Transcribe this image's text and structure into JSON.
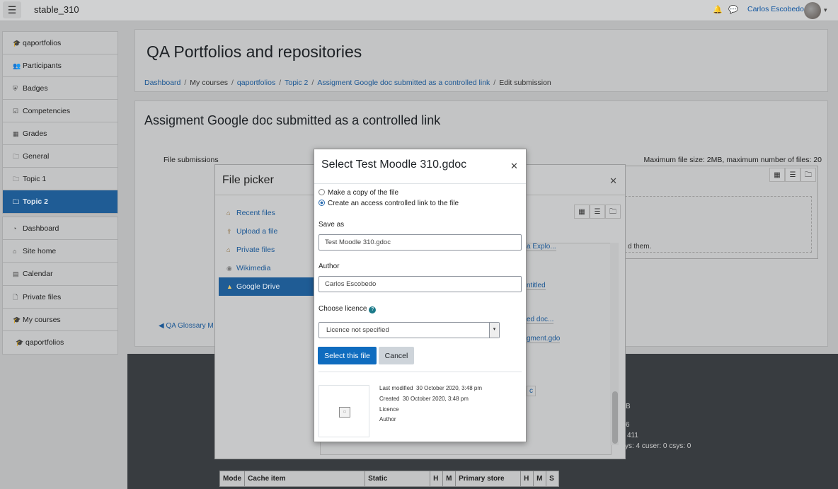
{
  "navbar": {
    "site_name": "stable_310",
    "user_name": "Carlos Escobedo"
  },
  "drawer": {
    "group1": [
      {
        "icon": "graduation-cap-icon",
        "glyph": "🎓",
        "label": "qaportfolios"
      },
      {
        "icon": "users-icon",
        "glyph": "👥",
        "label": "Participants"
      },
      {
        "icon": "shield-icon",
        "glyph": "⛨",
        "label": "Badges"
      },
      {
        "icon": "check-square-icon",
        "glyph": "☑",
        "label": "Competencies"
      },
      {
        "icon": "table-icon",
        "glyph": "▦",
        "label": "Grades"
      },
      {
        "icon": "folder-icon",
        "glyph": "🗀",
        "label": "General"
      },
      {
        "icon": "folder-icon",
        "glyph": "🗀",
        "label": "Topic 1"
      },
      {
        "icon": "folder-icon",
        "glyph": "🗀",
        "label": "Topic 2"
      }
    ],
    "group2": [
      {
        "icon": "dashboard-icon",
        "glyph": "◔",
        "label": "Dashboard"
      },
      {
        "icon": "home-icon",
        "glyph": "⌂",
        "label": "Site home"
      },
      {
        "icon": "calendar-icon",
        "glyph": "▤",
        "label": "Calendar"
      }
    ],
    "group3": [
      {
        "icon": "file-icon",
        "glyph": "🗋",
        "label": "Private files"
      }
    ],
    "group4": [
      {
        "icon": "graduation-cap-icon",
        "glyph": "🎓",
        "label": "My courses"
      },
      {
        "icon": "graduation-cap-icon",
        "glyph": "🎓",
        "label": "qaportfolios"
      }
    ],
    "active_label": "Topic 2"
  },
  "header": {
    "title": "QA Portfolios and repositories",
    "breadcrumb": [
      "Dashboard",
      "My courses",
      "qaportfolios",
      "Topic 2",
      "Assigment Google doc submitted as a controlled link",
      "Edit submission"
    ]
  },
  "main": {
    "title": "Assigment Google doc submitted as a controlled link",
    "file_submissions_label": "File submissions",
    "max_size_text": "Maximum file size: 2MB, maximum number of files: 20",
    "dropzone_text": "d them.",
    "prev_link": "◀ QA Glossary M"
  },
  "footer": {
    "lines": [
      "B",
      "6",
      "411",
      "sys: 4 cuser: 0 csys: 0"
    ],
    "cache_headers": [
      "Mode",
      "Cache item",
      "Static",
      "H",
      "M",
      "Primary store",
      "H",
      "M",
      "S"
    ]
  },
  "file_picker": {
    "title": "File picker",
    "nav": [
      {
        "icon": "recent-files-icon",
        "label": "Recent files"
      },
      {
        "icon": "upload-icon",
        "label": "Upload a file"
      },
      {
        "icon": "private-files-icon",
        "label": "Private files"
      },
      {
        "icon": "wikimedia-icon",
        "label": "Wikimedia"
      },
      {
        "icon": "google-drive-icon",
        "label": "Google Drive"
      }
    ],
    "peek_links": [
      "a Explo...",
      "ntitled",
      "ed doc...",
      "gment.gdo",
      "c"
    ]
  },
  "dialog": {
    "title": "Select Test Moodle 310.gdoc",
    "option_copy": "Make a copy of the file",
    "option_link": "Create an access controlled link to the file",
    "save_as_label": "Save as",
    "save_as_value": "Test Moodle 310.gdoc",
    "author_label": "Author",
    "author_value": "Carlos Escobedo",
    "licence_label": "Choose licence",
    "licence_value": "Licence not specified",
    "select_button": "Select this file",
    "cancel_button": "Cancel",
    "meta": {
      "last_modified_label": "Last modified",
      "last_modified_value": "30 October 2020, 3:48 pm",
      "created_label": "Created",
      "created_value": "30 October 2020, 3:48 pm",
      "licence_label": "Licence",
      "author_label": "Author"
    }
  },
  "colors": {
    "primary": "#0f6cbf",
    "link": "#1b5794",
    "active_nav": "#1f5c95",
    "footer": "#383c40"
  }
}
